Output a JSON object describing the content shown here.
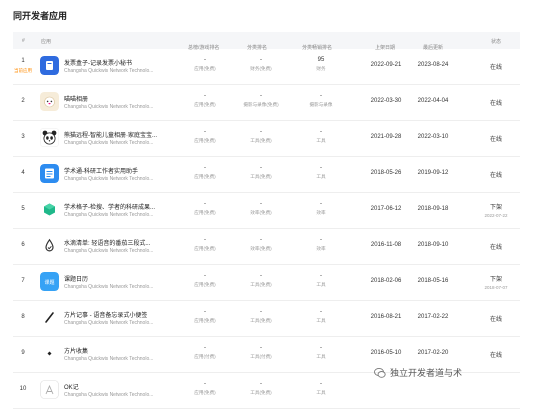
{
  "page_title": "同开发者应用",
  "columns": {
    "index": "#",
    "app": "应用",
    "app_rank": "总榜/游戏排名",
    "category_rank": "分类排名",
    "category_sales_rank": "分类畅销排名",
    "release_date": "上架日期",
    "last_update": "最后更新",
    "status": "状态"
  },
  "apps": [
    {
      "rank": "1",
      "rank_tag": "当前应用",
      "name": "发票盒子-记录发票小秘书",
      "developer": "Changsha Quickwis Network Technolo...",
      "app_rank": "-",
      "app_rank_sub": "应用(免费)",
      "cat_rank": "-",
      "cat_rank_sub": "财务(免费)",
      "sales_rank": "95",
      "sales_rank_sub": "财务",
      "release": "2022-09-21",
      "update": "2023-08-24",
      "status": "在线",
      "status_sub": "",
      "icon": "invoice-icon",
      "icon_color": "#2f6bdf"
    },
    {
      "rank": "2",
      "rank_tag": "",
      "name": "喵喵相册",
      "developer": "Changsha Quickwis Network Technolo...",
      "app_rank": "-",
      "app_rank_sub": "应用(免费)",
      "cat_rank": "-",
      "cat_rank_sub": "摄影与录像(免费)",
      "sales_rank": "-",
      "sales_rank_sub": "摄影与录像",
      "release": "2022-03-30",
      "update": "2022-04-04",
      "status": "在线",
      "status_sub": "",
      "icon": "cat-face-icon",
      "icon_color": "#f6ecd9"
    },
    {
      "rank": "3",
      "rank_tag": "",
      "name": "熊猫远程-智能儿童相册·家庭宝宝...",
      "developer": "Changsha Quickwis Network Technolo...",
      "app_rank": "-",
      "app_rank_sub": "应用(免费)",
      "cat_rank": "-",
      "cat_rank_sub": "工具(免费)",
      "sales_rank": "-",
      "sales_rank_sub": "工具",
      "release": "2021-09-28",
      "update": "2022-03-10",
      "status": "在线",
      "status_sub": "",
      "icon": "panda-icon",
      "icon_color": "#ffffff"
    },
    {
      "rank": "4",
      "rank_tag": "",
      "name": "学术通-科研工作者实用助手",
      "developer": "Changsha Quickwis Network Technolo...",
      "app_rank": "-",
      "app_rank_sub": "应用(免费)",
      "cat_rank": "-",
      "cat_rank_sub": "工具(免费)",
      "sales_rank": "-",
      "sales_rank_sub": "工具",
      "release": "2018-05-26",
      "update": "2019-09-12",
      "status": "在线",
      "status_sub": "",
      "icon": "book-icon",
      "icon_color": "#2d8cf0"
    },
    {
      "rank": "5",
      "rank_tag": "",
      "name": "学术格子-检搜、学者的科研成果...",
      "developer": "Changsha Quickwis Network Technolo...",
      "app_rank": "-",
      "app_rank_sub": "应用(免费)",
      "cat_rank": "-",
      "cat_rank_sub": "效率(免费)",
      "sales_rank": "-",
      "sales_rank_sub": "效率",
      "release": "2017-06-12",
      "update": "2018-09-18",
      "status": "下架",
      "status_sub": "2022-07-22",
      "icon": "cube-icon",
      "icon_color": "#ffffff"
    },
    {
      "rank": "6",
      "rank_tag": "",
      "name": "水滴清单: 轻语音的番茄三段式...",
      "developer": "Changsha Quickwis Network Technolo...",
      "app_rank": "-",
      "app_rank_sub": "应用(免费)",
      "cat_rank": "-",
      "cat_rank_sub": "效率(免费)",
      "sales_rank": "-",
      "sales_rank_sub": "效率",
      "release": "2016-11-08",
      "update": "2018-09-10",
      "status": "在线",
      "status_sub": "",
      "icon": "droplet-icon",
      "icon_color": "#ffffff"
    },
    {
      "rank": "7",
      "rank_tag": "",
      "name": "课题日历",
      "developer": "Changsha Quickwis Network Technolo...",
      "app_rank": "-",
      "app_rank_sub": "应用(免费)",
      "cat_rank": "-",
      "cat_rank_sub": "工具(免费)",
      "sales_rank": "-",
      "sales_rank_sub": "工具",
      "release": "2018-02-06",
      "update": "2018-05-16",
      "status": "下架",
      "status_sub": "2018-07-07",
      "icon": "calendar-icon",
      "icon_color": "#36a2f5"
    },
    {
      "rank": "8",
      "rank_tag": "",
      "name": "方片记事 - 语音备忘录式小便签",
      "developer": "Changsha Quickwis Network Technolo...",
      "app_rank": "-",
      "app_rank_sub": "应用(免费)",
      "cat_rank": "-",
      "cat_rank_sub": "工具(免费)",
      "sales_rank": "-",
      "sales_rank_sub": "工具",
      "release": "2016-08-21",
      "update": "2017-02-22",
      "status": "在线",
      "status_sub": "",
      "icon": "pen-icon",
      "icon_color": "#ffffff"
    },
    {
      "rank": "9",
      "rank_tag": "",
      "name": "方片收集",
      "developer": "Changsha Quickwis Network Technolo...",
      "app_rank": "-",
      "app_rank_sub": "应用(付费)",
      "cat_rank": "-",
      "cat_rank_sub": "工具(付费)",
      "sales_rank": "-",
      "sales_rank_sub": "工具",
      "release": "2016-05-10",
      "update": "2017-02-20",
      "status": "在线",
      "status_sub": "",
      "icon": "diamond-icon",
      "icon_color": "#ffffff"
    },
    {
      "rank": "10",
      "rank_tag": "",
      "name": "OK记",
      "developer": "Changsha Quickwis Network Technolo...",
      "app_rank": "-",
      "app_rank_sub": "应用(免费)",
      "cat_rank": "-",
      "cat_rank_sub": "工具(免费)",
      "sales_rank": "-",
      "sales_rank_sub": "工具",
      "release": "",
      "update": "",
      "status": "",
      "status_sub": "",
      "icon": "app-store-icon",
      "icon_color": "#ffffff"
    }
  ],
  "watermark": "独立开发者道与术"
}
